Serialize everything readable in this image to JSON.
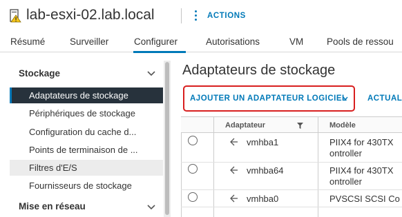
{
  "header": {
    "title": "lab-esxi-02.lab.local",
    "host_icon": "host-warning-icon",
    "actions_label": "ACTIONS",
    "kebab_icon": "vertical-ellipsis-icon"
  },
  "tabs": [
    {
      "label": "Résumé",
      "active": false
    },
    {
      "label": "Surveiller",
      "active": false
    },
    {
      "label": "Configurer",
      "active": true
    },
    {
      "label": "Autorisations",
      "active": false
    },
    {
      "label": "VM",
      "active": false
    },
    {
      "label": "Pools de ressou",
      "active": false
    }
  ],
  "sidebar": {
    "sections": [
      {
        "label": "Stockage",
        "expanded": true
      },
      {
        "label": "Mise en réseau",
        "expanded": true
      }
    ],
    "items": [
      {
        "label": "Adaptateurs de stockage",
        "selected": true
      },
      {
        "label": "Périphériques de stockage",
        "selected": false
      },
      {
        "label": "Configuration du cache d...",
        "selected": false
      },
      {
        "label": "Points de terminaison de ...",
        "selected": false
      },
      {
        "label": "Filtres d'E/S",
        "selected": false
      },
      {
        "label": "Fournisseurs de stockage",
        "selected": false
      }
    ]
  },
  "main": {
    "title": "Adaptateurs de stockage",
    "add_button_label": "AJOUTER UN ADAPTATEUR LOGICIEL",
    "refresh_button_label": "ACTUALI",
    "accent_color": "#0079b8",
    "highlight_color": "#d81e1e"
  },
  "table": {
    "columns": [
      "Adaptateur",
      "Modèle"
    ],
    "rows": [
      {
        "adapter": "vmhba1",
        "model_line1": "PIIX4 for 430TX",
        "model_line2": "ontroller"
      },
      {
        "adapter": "vmhba64",
        "model_line1": "PIIX4 for 430TX",
        "model_line2": "ontroller"
      },
      {
        "adapter": "vmhba0",
        "model_line1": "PVSCSI SCSI Co",
        "model_line2": ""
      }
    ]
  }
}
